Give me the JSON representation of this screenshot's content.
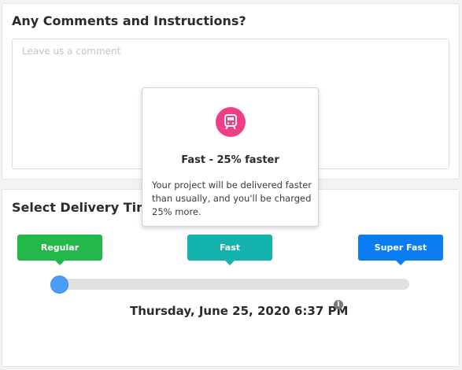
{
  "comments": {
    "title": "Any Comments and Instructions?",
    "placeholder": "Leave us a comment",
    "value": ""
  },
  "delivery": {
    "title": "Select Delivery Time",
    "options": [
      {
        "label": "Regular",
        "color": "#23b84a"
      },
      {
        "label": "Fast",
        "color": "#14b3ad"
      },
      {
        "label": "Super Fast",
        "color": "#0a7df2"
      }
    ],
    "slider_position": 0,
    "date": "Thursday, June 25, 2020 6:37 PM",
    "info_icon": "info-icon"
  },
  "tooltip": {
    "icon": "train-icon",
    "icon_color": "#ee3f86",
    "title": "Fast - 25% faster",
    "body": "Your project will be delivered faster than usually, and you'll be charged 25% more."
  }
}
